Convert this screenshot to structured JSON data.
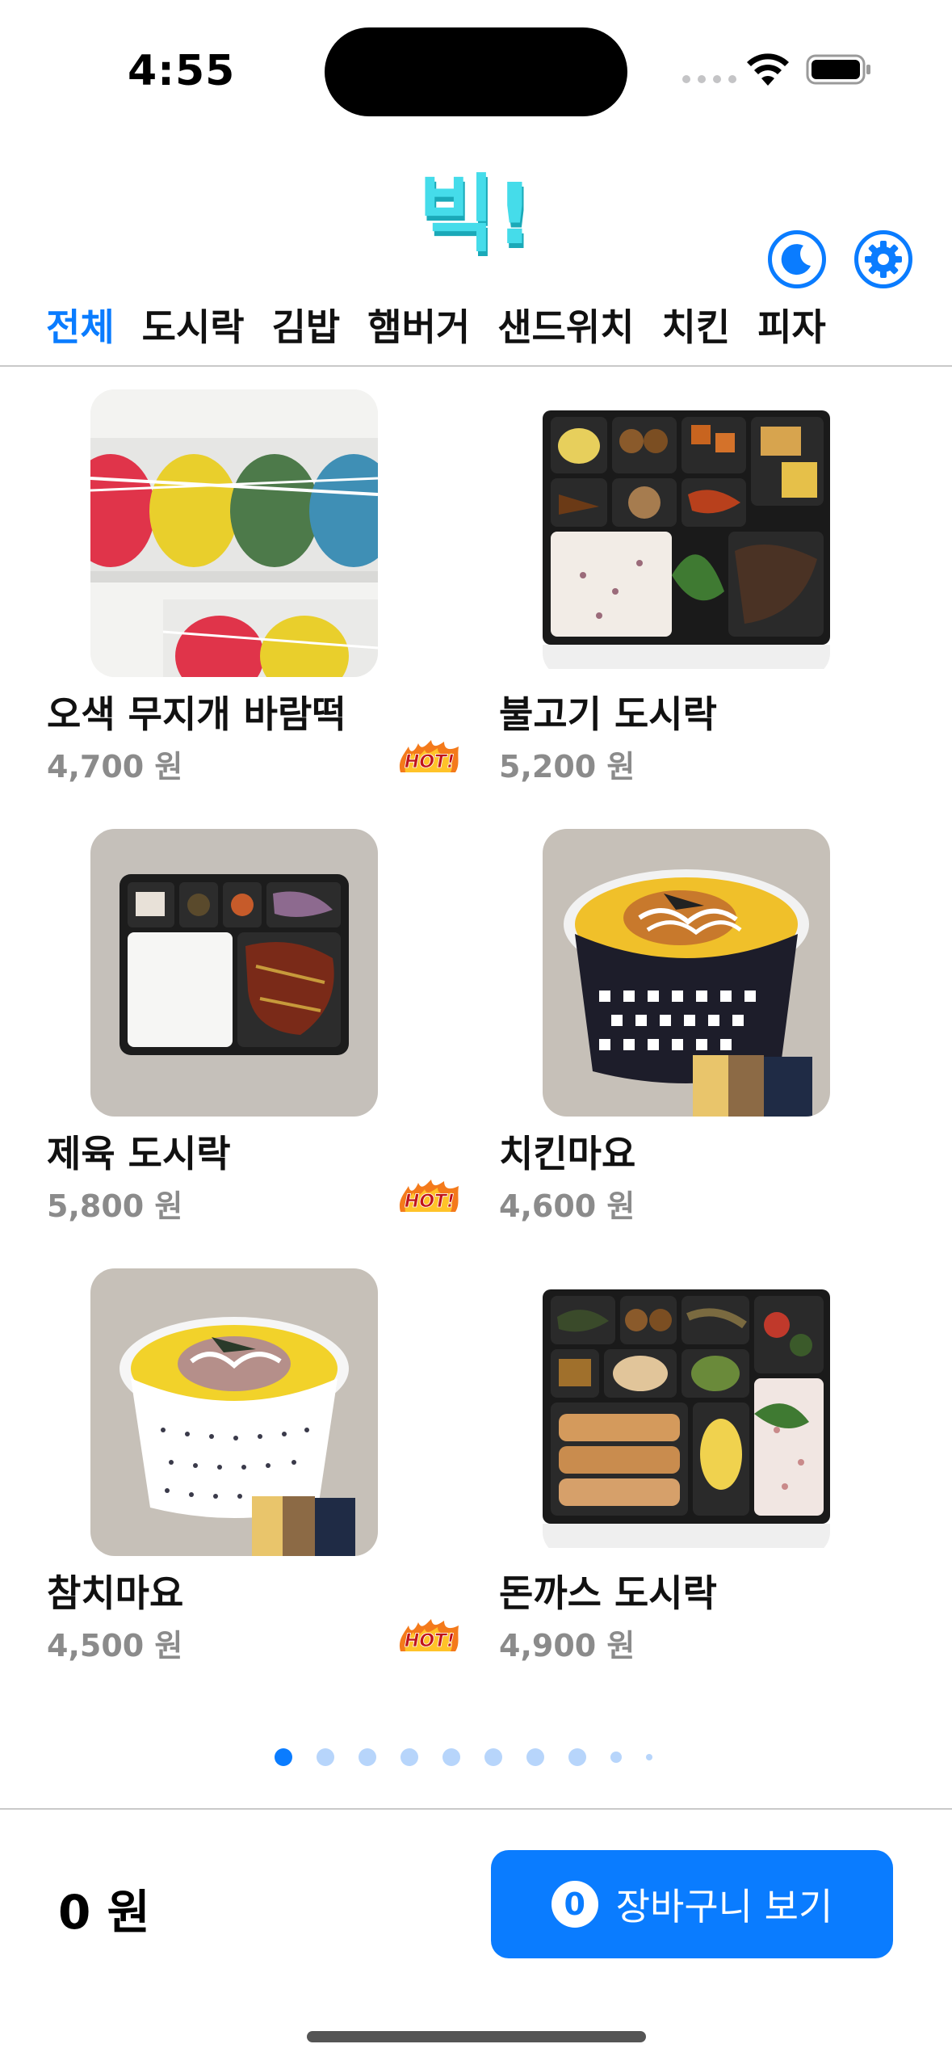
{
  "status_bar": {
    "time": "4:55"
  },
  "header": {
    "logo_text": "빅!"
  },
  "tabs": [
    {
      "label": "전체",
      "active": true
    },
    {
      "label": "도시락",
      "active": false
    },
    {
      "label": "김밥",
      "active": false
    },
    {
      "label": "햄버거",
      "active": false
    },
    {
      "label": "샌드위치",
      "active": false
    },
    {
      "label": "치킨",
      "active": false
    },
    {
      "label": "피자",
      "active": false
    }
  ],
  "products": [
    {
      "name": "오색 무지개 바람떡",
      "price": "4,700 원",
      "hot": true,
      "image": "rainbow-rice-cake"
    },
    {
      "name": "불고기 도시락",
      "price": "5,200 원",
      "hot": false,
      "image": "bulgogi-lunchbox"
    },
    {
      "name": "제육 도시락",
      "price": "5,800 원",
      "hot": true,
      "image": "jeyuk-lunchbox"
    },
    {
      "name": "치킨마요",
      "price": "4,600 원",
      "hot": false,
      "image": "chicken-mayo-bowl"
    },
    {
      "name": "참치마요",
      "price": "4,500 원",
      "hot": true,
      "image": "tuna-mayo-bowl"
    },
    {
      "name": "돈까스 도시락",
      "price": "4,900 원",
      "hot": false,
      "image": "pork-cutlet-lunchbox"
    }
  ],
  "hot_badge": "HOT!",
  "pagination": {
    "current": 1,
    "total": 10
  },
  "bottom": {
    "total_price": "0 원",
    "cart_count": "0",
    "cart_label": "장바구니 보기"
  },
  "colors": {
    "accent": "#0a7cff",
    "price_gray": "#8b8b8b",
    "logo": "#3fd3e0"
  }
}
